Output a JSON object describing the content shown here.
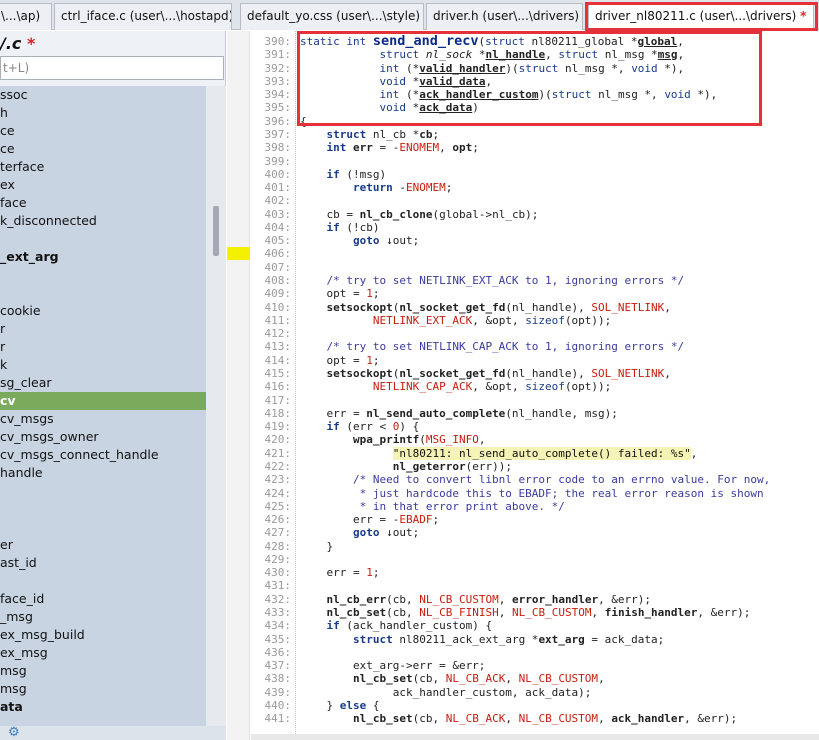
{
  "tabs": [
    {
      "label": "\\...\\ap)",
      "active": false
    },
    {
      "label": "ctrl_iface.c (user\\...\\hostapd)",
      "active": false
    },
    {
      "label": "default_yo.css (user\\...\\style)",
      "active": false
    },
    {
      "label": "driver.h (user\\...\\drivers)",
      "active": false
    },
    {
      "label": "driver_nl80211.c (user\\...\\drivers)",
      "active": true,
      "modified": "*",
      "close": "✕"
    }
  ],
  "left_panel": {
    "title": "/.c",
    "title_modified": "*",
    "filter_placeholder": "t+L)",
    "items": [
      {
        "label": "ssoc",
        "bold": false,
        "selected": false
      },
      {
        "label": "h",
        "bold": false,
        "selected": false
      },
      {
        "label": "ce",
        "bold": false,
        "selected": false
      },
      {
        "label": "ce",
        "bold": false,
        "selected": false
      },
      {
        "label": "terface",
        "bold": false,
        "selected": false
      },
      {
        "label": "ex",
        "bold": false,
        "selected": false
      },
      {
        "label": "face",
        "bold": false,
        "selected": false
      },
      {
        "label": "k_disconnected",
        "bold": false,
        "selected": false
      },
      {
        "label": "",
        "bold": false,
        "selected": false
      },
      {
        "label": "_ext_arg",
        "bold": true,
        "selected": false
      },
      {
        "label": "",
        "bold": false,
        "selected": false
      },
      {
        "label": "",
        "bold": false,
        "selected": false
      },
      {
        "label": "cookie",
        "bold": false,
        "selected": false
      },
      {
        "label": "r",
        "bold": false,
        "selected": false
      },
      {
        "label": "r",
        "bold": false,
        "selected": false
      },
      {
        "label": "k",
        "bold": false,
        "selected": false
      },
      {
        "label": "sg_clear",
        "bold": false,
        "selected": false
      },
      {
        "label": "cv",
        "bold": true,
        "selected": true
      },
      {
        "label": "cv_msgs",
        "bold": false,
        "selected": false
      },
      {
        "label": "cv_msgs_owner",
        "bold": false,
        "selected": false
      },
      {
        "label": "cv_msgs_connect_handle",
        "bold": false,
        "selected": false
      },
      {
        "label": "handle",
        "bold": false,
        "selected": false
      },
      {
        "label": "",
        "bold": false,
        "selected": false
      },
      {
        "label": "",
        "bold": false,
        "selected": false
      },
      {
        "label": "",
        "bold": false,
        "selected": false
      },
      {
        "label": "er",
        "bold": false,
        "selected": false
      },
      {
        "label": "ast_id",
        "bold": false,
        "selected": false
      },
      {
        "label": "",
        "bold": false,
        "selected": false
      },
      {
        "label": "face_id",
        "bold": false,
        "selected": false
      },
      {
        "label": "_msg",
        "bold": false,
        "selected": false
      },
      {
        "label": "ex_msg_build",
        "bold": false,
        "selected": false
      },
      {
        "label": "ex_msg",
        "bold": false,
        "selected": false
      },
      {
        "label": "msg",
        "bold": false,
        "selected": false
      },
      {
        "label": "msg",
        "bold": false,
        "selected": false
      },
      {
        "label": "ata",
        "bold": true,
        "selected": false
      }
    ],
    "gear_icon": "⚙"
  },
  "code": {
    "lines": [
      {
        "n": "390:",
        "html": "<span class='kw'>static int</span> <span class='fn big'>send_and_recv</span>(<span class='kw'>struct</span> nl80211_global *<span class='bold ul'>global</span>,"
      },
      {
        "n": "391:",
        "html": "            <span class='kw'>struct</span> <span class='it'>nl_sock</span> *<span class='bold ul'>nl_handle</span>, <span class='kw'>struct</span> nl_msg *<span class='bold ul'>msg</span>,"
      },
      {
        "n": "392:",
        "html": "            <span class='kw'>int</span> (*<span class='bold ul'>valid_handler</span>)(<span class='kw'>struct</span> nl_msg *, <span class='kw'>void</span> *),"
      },
      {
        "n": "393:",
        "html": "            <span class='kw'>void</span> *<span class='bold ul'>valid_data</span>,"
      },
      {
        "n": "394:",
        "html": "            <span class='kw'>int</span> (*<span class='bold ul'>ack_handler_custom</span>)(<span class='kw'>struct</span> nl_msg *, <span class='kw'>void</span> *),"
      },
      {
        "n": "395:",
        "html": "            <span class='kw'>void</span> *<span class='bold ul'>ack_data</span>)"
      },
      {
        "n": "396:",
        "html": "{"
      },
      {
        "n": "397:",
        "html": "    <span class='kw bold'>struct</span> nl_cb *<span class='bold'>cb</span>;"
      },
      {
        "n": "398:",
        "html": "    <span class='kw bold'>int</span> <span class='bold'>err</span> = -<span class='mac'>ENOMEM</span>, <span class='bold'>opt</span>;"
      },
      {
        "n": "399:",
        "html": ""
      },
      {
        "n": "400:",
        "html": "    <span class='kw bold'>if</span> (!msg)"
      },
      {
        "n": "401:",
        "html": "        <span class='kw bold'>return</span> -<span class='mac'>ENOMEM</span>;"
      },
      {
        "n": "402:",
        "html": ""
      },
      {
        "n": "403:",
        "html": "    cb = <span class='bold'>nl_cb_clone</span>(global->nl_cb);"
      },
      {
        "n": "404:",
        "html": "    <span class='kw bold'>if</span> (!cb)"
      },
      {
        "n": "405:",
        "html": "        <span class='kw bold'>goto</span> ↓out;"
      },
      {
        "n": "406:",
        "html": ""
      },
      {
        "n": "407:",
        "html": ""
      },
      {
        "n": "408:",
        "html": "    <span class='cm'>/* try to set NETLINK_EXT_ACK to 1, ignoring errors */</span>"
      },
      {
        "n": "409:",
        "html": "    opt = <span class='num'>1</span>;"
      },
      {
        "n": "410:",
        "html": "    <span class='bold'>setsockopt</span>(<span class='bold'>nl_socket_get_fd</span>(nl_handle), <span class='mac'>SOL_NETLINK</span>,"
      },
      {
        "n": "411:",
        "html": "           <span class='mac'>NETLINK_EXT_ACK</span>, &amp;opt, <span class='kw'>sizeof</span>(opt));"
      },
      {
        "n": "412:",
        "html": ""
      },
      {
        "n": "413:",
        "html": "    <span class='cm'>/* try to set NETLINK_CAP_ACK to 1, ignoring errors */</span>"
      },
      {
        "n": "414:",
        "html": "    opt = <span class='num'>1</span>;"
      },
      {
        "n": "415:",
        "html": "    <span class='bold'>setsockopt</span>(<span class='bold'>nl_socket_get_fd</span>(nl_handle), <span class='mac'>SOL_NETLINK</span>,"
      },
      {
        "n": "416:",
        "html": "           <span class='mac'>NETLINK_CAP_ACK</span>, &amp;opt, <span class='kw'>sizeof</span>(opt));"
      },
      {
        "n": "417:",
        "html": ""
      },
      {
        "n": "418:",
        "html": "    err = <span class='bold'>nl_send_auto_complete</span>(nl_handle, msg);"
      },
      {
        "n": "419:",
        "html": "    <span class='kw bold'>if</span> (err &lt; <span class='num'>0</span>) {"
      },
      {
        "n": "420:",
        "html": "        <span class='bold'>wpa_printf</span>(<span class='mac'>MSG_INFO</span>,"
      },
      {
        "n": "421:",
        "html": "              <span class='str'>\"nl80211: nl_send_auto_complete() failed: %s\"</span>,"
      },
      {
        "n": "422:",
        "html": "              <span class='bold'>nl_geterror</span>(err));"
      },
      {
        "n": "423:",
        "html": "        <span class='cm'>/* Need to convert libnl error code to an errno value. For now,</span>"
      },
      {
        "n": "424:",
        "html": "<span class='cm'>         * just hardcode this to EBADF; the real error reason is shown</span>"
      },
      {
        "n": "425:",
        "html": "<span class='cm'>         * in that error print above. */</span>"
      },
      {
        "n": "426:",
        "html": "        err = -<span class='mac'>EBADF</span>;"
      },
      {
        "n": "427:",
        "html": "        <span class='kw bold'>goto</span> ↓out;"
      },
      {
        "n": "428:",
        "html": "    }"
      },
      {
        "n": "429:",
        "html": ""
      },
      {
        "n": "430:",
        "html": "    err = <span class='num'>1</span>;"
      },
      {
        "n": "431:",
        "html": ""
      },
      {
        "n": "432:",
        "html": "    <span class='bold'>nl_cb_err</span>(cb, <span class='mac'>NL_CB_CUSTOM</span>, <span class='bold'>error_handler</span>, &amp;err);"
      },
      {
        "n": "433:",
        "html": "    <span class='bold'>nl_cb_set</span>(cb, <span class='mac'>NL_CB_FINISH</span>, <span class='mac'>NL_CB_CUSTOM</span>, <span class='bold'>finish_handler</span>, &amp;err);"
      },
      {
        "n": "434:",
        "html": "    <span class='kw bold'>if</span> (ack_handler_custom) {"
      },
      {
        "n": "435:",
        "html": "        <span class='kw bold'>struct</span> nl80211_ack_ext_arg *<span class='bold'>ext_arg</span> = ack_data;"
      },
      {
        "n": "436:",
        "html": ""
      },
      {
        "n": "437:",
        "html": "        ext_arg->err = &amp;err;"
      },
      {
        "n": "438:",
        "html": "        <span class='bold'>nl_cb_set</span>(cb, <span class='mac'>NL_CB_ACK</span>, <span class='mac'>NL_CB_CUSTOM</span>,"
      },
      {
        "n": "439:",
        "html": "              ack_handler_custom, ack_data);"
      },
      {
        "n": "440:",
        "html": "    } <span class='kw bold'>else</span> {"
      },
      {
        "n": "441:",
        "html": "        <span class='bold'>nl_cb_set</span>(cb, <span class='mac'>NL_CB_ACK</span>, <span class='mac'>NL_CB_CUSTOM</span>, <span class='bold'>ack_handler</span>, &amp;err);"
      }
    ]
  },
  "colors": {
    "annotation_red": "#e5323a",
    "selection_green": "#7aaa5c",
    "bookmark_yellow": "#f4f100"
  }
}
